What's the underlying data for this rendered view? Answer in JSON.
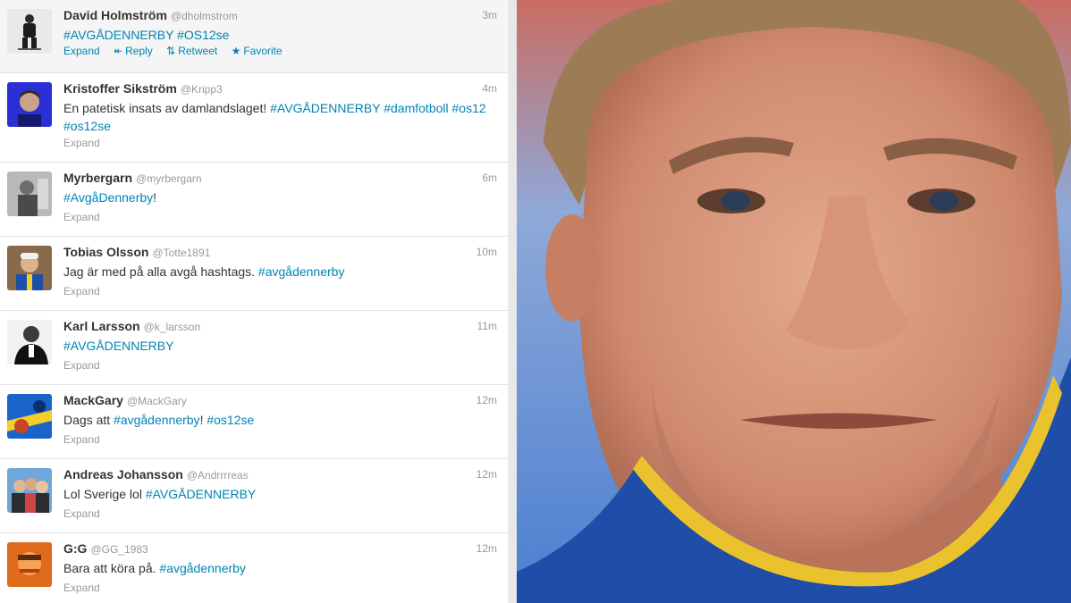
{
  "tweets": [
    {
      "name": "David Holmström",
      "handle": "@dholmstrom",
      "time": "3m",
      "segments": [
        {
          "text": "#AVGÅDENNERBY",
          "tag": true
        },
        {
          "text": " ",
          "tag": false
        },
        {
          "text": "#OS12se",
          "tag": true
        }
      ],
      "actions": {
        "expand": "Expand",
        "reply": "Reply",
        "retweet": "Retweet",
        "favorite": "Favorite"
      },
      "avatar_icon": "hockey-player-avatar"
    },
    {
      "name": "Kristoffer Sikström",
      "handle": "@Kripp3",
      "time": "4m",
      "segments": [
        {
          "text": "En patetisk insats av damlandslaget! ",
          "tag": false
        },
        {
          "text": "#AVGÅDENNERBY",
          "tag": true
        },
        {
          "text": " ",
          "tag": false
        },
        {
          "text": "#damfotboll",
          "tag": true
        },
        {
          "text": " ",
          "tag": false
        },
        {
          "text": "#os12",
          "tag": true
        },
        {
          "text": " ",
          "tag": false
        },
        {
          "text": "#os12se",
          "tag": true
        }
      ],
      "actions": {
        "expand": "Expand"
      },
      "avatar_icon": "person-blue-avatar"
    },
    {
      "name": "Myrbergarn",
      "handle": "@myrbergarn",
      "time": "6m",
      "segments": [
        {
          "text": "#AvgåDennerby",
          "tag": true
        },
        {
          "text": "!",
          "tag": false
        }
      ],
      "actions": {
        "expand": "Expand"
      },
      "avatar_icon": "person-gray-avatar"
    },
    {
      "name": "Tobias Olsson",
      "handle": "@Totte1891",
      "time": "10m",
      "segments": [
        {
          "text": "Jag är med på alla avgå hashtags. ",
          "tag": false
        },
        {
          "text": "#avgådennerby",
          "tag": true
        }
      ],
      "actions": {
        "expand": "Expand"
      },
      "avatar_icon": "person-cap-avatar"
    },
    {
      "name": "Karl Larsson",
      "handle": "@k_larsson",
      "time": "11m",
      "segments": [
        {
          "text": "#AVGÅDENNERBY",
          "tag": true
        }
      ],
      "actions": {
        "expand": "Expand"
      },
      "avatar_icon": "person-bw-avatar"
    },
    {
      "name": "MackGary",
      "handle": "@MackGary",
      "time": "12m",
      "segments": [
        {
          "text": "Dags att ",
          "tag": false
        },
        {
          "text": "#avgådennerby",
          "tag": true
        },
        {
          "text": "! ",
          "tag": false
        },
        {
          "text": "#os12se",
          "tag": true
        }
      ],
      "actions": {
        "expand": "Expand"
      },
      "avatar_icon": "badge-avatar"
    },
    {
      "name": "Andreas Johansson",
      "handle": "@Andrrrreas",
      "time": "12m",
      "segments": [
        {
          "text": "Lol Sverige lol ",
          "tag": false
        },
        {
          "text": "#AVGÅDENNERBY",
          "tag": true
        }
      ],
      "actions": {
        "expand": "Expand"
      },
      "avatar_icon": "group-avatar"
    },
    {
      "name": "G:G",
      "handle": "@GG_1983",
      "time": "12m",
      "segments": [
        {
          "text": "Bara att köra på. ",
          "tag": false
        },
        {
          "text": "#avgådennerby",
          "tag": true
        }
      ],
      "actions": {
        "expand": "Expand"
      },
      "avatar_icon": "person-orange-avatar"
    }
  ],
  "icons": {
    "reply": "reply-icon",
    "retweet": "retweet-icon",
    "favorite": "star-icon"
  },
  "colors": {
    "link": "#0084b4",
    "text": "#333333",
    "muted": "#999999",
    "hover_bg": "#f5f5f5"
  },
  "photo": {
    "subject": "coach-portrait",
    "jacket_color": "#1f4ea8",
    "collar_color": "#e9c22e"
  }
}
